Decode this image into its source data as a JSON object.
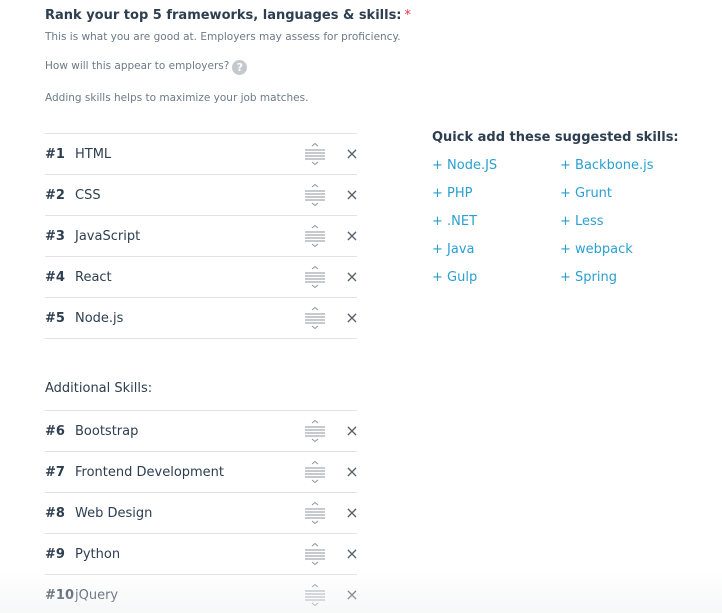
{
  "header": {
    "title": "Rank your top 5 frameworks, languages & skills:",
    "required_mark": "*",
    "description": "This is what you are good at. Employers may assess for proficiency.",
    "appear_question": "How will this appear to employers?",
    "help_icon": "question-circle-icon",
    "help_glyph": "?",
    "note": "Adding skills helps to maximize your job matches."
  },
  "top_skills": [
    {
      "rank": "#1",
      "name": "HTML"
    },
    {
      "rank": "#2",
      "name": "CSS"
    },
    {
      "rank": "#3",
      "name": "JavaScript"
    },
    {
      "rank": "#4",
      "name": "React"
    },
    {
      "rank": "#5",
      "name": "Node.js"
    }
  ],
  "additional": {
    "label": "Additional Skills:",
    "skills": [
      {
        "rank": "#6",
        "name": "Bootstrap"
      },
      {
        "rank": "#7",
        "name": "Frontend Development"
      },
      {
        "rank": "#8",
        "name": "Web Design"
      },
      {
        "rank": "#9",
        "name": "Python"
      },
      {
        "rank": "#10",
        "name": "jQuery"
      }
    ]
  },
  "row_icons": {
    "drag": "drag-handle-icon",
    "remove": "close-icon",
    "remove_glyph": "×"
  },
  "suggestions": {
    "title": "Quick add these suggested skills:",
    "items": [
      "+ Node.JS",
      "+ Backbone.js",
      "+ PHP",
      "+ Grunt",
      "+ .NET",
      "+ Less",
      "+ Java",
      "+ webpack",
      "+ Gulp",
      "+ Spring"
    ]
  },
  "colors": {
    "link": "#2a9fd0",
    "required": "#e0334a",
    "text": "#2c3e50",
    "muted": "#6b7a89",
    "divider": "#dfe3e7"
  }
}
